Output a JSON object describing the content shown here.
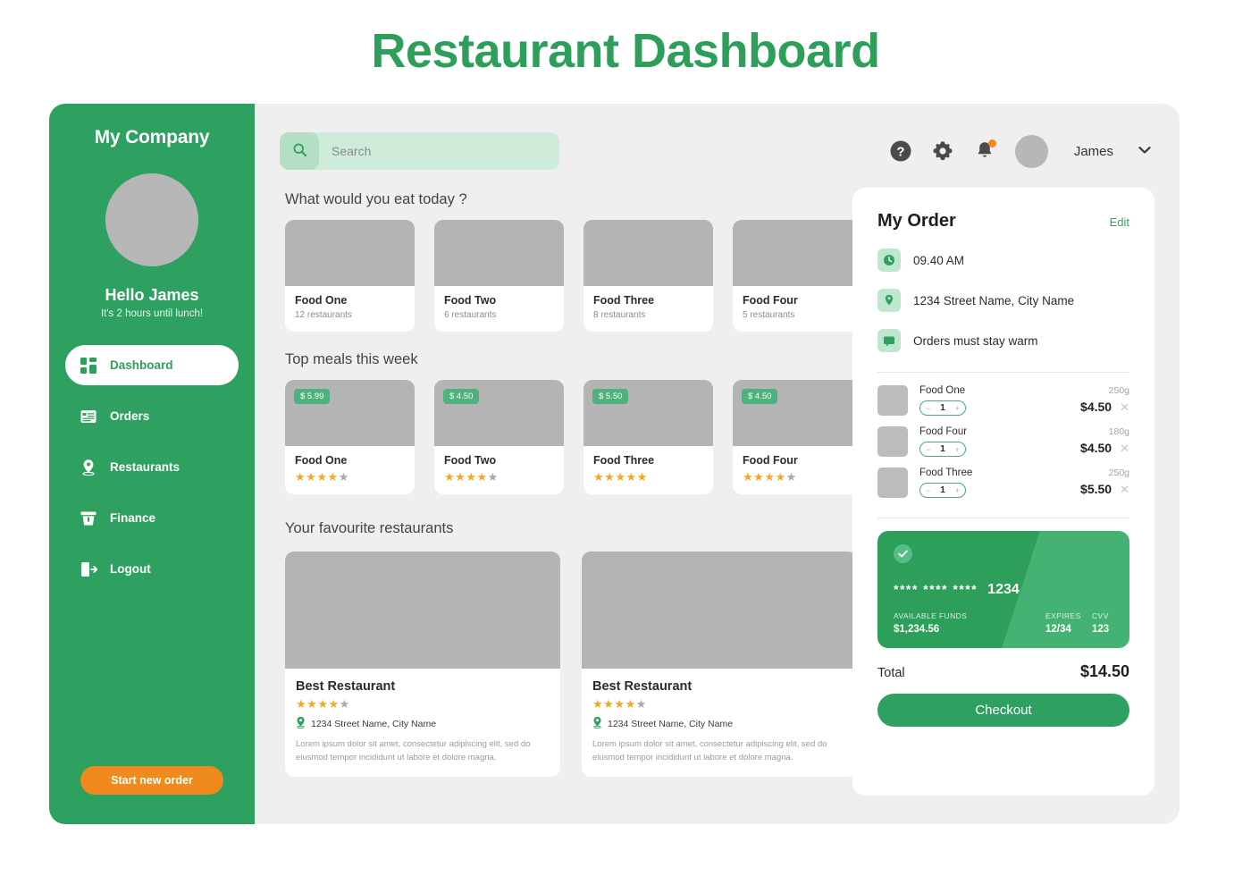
{
  "page": {
    "title": "Restaurant Dashboard",
    "accent_green": "#2EA160",
    "accent_orange": "#F08A1C"
  },
  "sidebar": {
    "company": "My Company",
    "greeting": "Hello James",
    "greeting_sub": "It's 2 hours until lunch!",
    "items": [
      {
        "label": "Dashboard",
        "icon": "grid-icon",
        "active": true
      },
      {
        "label": "Orders",
        "icon": "receipt-icon",
        "active": false
      },
      {
        "label": "Restaurants",
        "icon": "location-icon",
        "active": false
      },
      {
        "label": "Finance",
        "icon": "bank-icon",
        "active": false
      },
      {
        "label": "Logout",
        "icon": "logout-icon",
        "active": false
      }
    ],
    "cta": "Start new order"
  },
  "topbar": {
    "search_placeholder": "Search",
    "search_value": "",
    "icons": [
      "help-icon",
      "gear-icon",
      "bell-icon"
    ],
    "user_name": "James",
    "notification": true
  },
  "sections": {
    "eat_today": "What would you eat today ?",
    "top_meals": "Top meals this week",
    "favourites": "Your favourite restaurants"
  },
  "foods": [
    {
      "name": "Food One",
      "sub": "12 restaurants"
    },
    {
      "name": "Food Two",
      "sub": "6 restaurants"
    },
    {
      "name": "Food Three",
      "sub": "8 restaurants"
    },
    {
      "name": "Food Four",
      "sub": "5 restaurants"
    }
  ],
  "meals": [
    {
      "name": "Food One",
      "price": "$ 5.99",
      "rating": 4
    },
    {
      "name": "Food Two",
      "price": "$ 4.50",
      "rating": 4
    },
    {
      "name": "Food Three",
      "price": "$ 5.50",
      "rating": 5
    },
    {
      "name": "Food Four",
      "price": "$ 4.50",
      "rating": 4
    }
  ],
  "restaurants": [
    {
      "name": "Best Restaurant",
      "rating": 4,
      "address": "1234 Street Name, City Name",
      "desc": "Lorem ipsum dolor sit amet, consectetur adipiscing elit, sed do eiusmod tempor incididunt ut labore et dolore magna."
    },
    {
      "name": "Best Restaurant",
      "rating": 4,
      "address": "1234 Street Name, City Name",
      "desc": "Lorem ipsum dolor sit amet, consectetur adipiscing elit, sed do eiusmod tempor incididunt ut labore et dolore magna."
    }
  ],
  "order": {
    "title": "My Order",
    "edit": "Edit",
    "meta": [
      {
        "icon": "clock-icon",
        "text": "09.40 AM"
      },
      {
        "icon": "location-icon",
        "text": "1234 Street Name, City Name"
      },
      {
        "icon": "message-icon",
        "text": "Orders must stay warm"
      }
    ],
    "items": [
      {
        "name": "Food One",
        "weight": "250g",
        "qty": "1",
        "price": "$4.50"
      },
      {
        "name": "Food Four",
        "weight": "180g",
        "qty": "1",
        "price": "$4.50"
      },
      {
        "name": "Food Three",
        "weight": "250g",
        "qty": "1",
        "price": "$5.50"
      }
    ],
    "card": {
      "mask": "**** **** ****",
      "last4": "1234",
      "funds_label": "AVAILABLE FUNDS",
      "funds_value": "$1,234.56",
      "expires_label": "EXPIRES",
      "expires_value": "12/34",
      "cvv_label": "CVV",
      "cvv_value": "123"
    },
    "total_label": "Total",
    "total_value": "$14.50",
    "checkout": "Checkout"
  }
}
